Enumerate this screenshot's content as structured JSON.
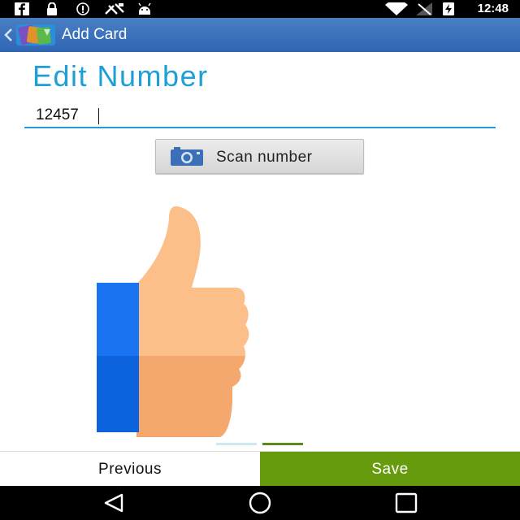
{
  "status_bar": {
    "time": "12:48",
    "icons": [
      "facebook-icon",
      "lock-icon",
      "info-icon",
      "app-icon",
      "android-icon",
      "wifi-icon",
      "signal-icon",
      "battery-charging-icon"
    ]
  },
  "action_bar": {
    "title": "Add Card",
    "color": "#3a70bb"
  },
  "main": {
    "title": "Edit Number",
    "number_value": "12457",
    "scan_button_label": "Scan number",
    "illustration": "thumbs-up-illustration",
    "pager": {
      "pages": 2,
      "current": 2
    }
  },
  "bottom_bar": {
    "previous_label": "Previous",
    "save_label": "Save",
    "save_color": "#669b0e"
  },
  "nav_bar": {
    "buttons": [
      "back-icon",
      "home-icon",
      "recents-icon"
    ]
  },
  "colors": {
    "accent": "#1ea0d6",
    "thumb_skin": "#fdbf8a",
    "cuff": "#1a73f0"
  }
}
